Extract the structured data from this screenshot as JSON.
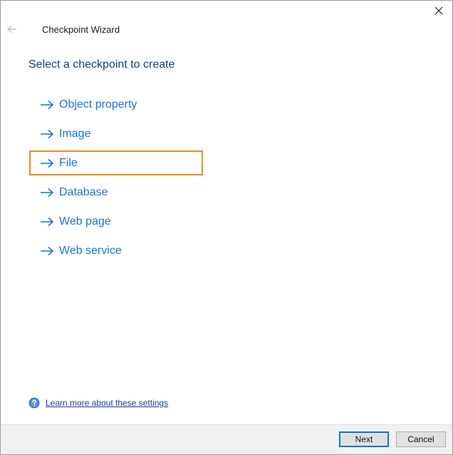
{
  "window": {
    "title": "Checkpoint Wizard",
    "close_icon": "close-icon",
    "back_icon": "back-arrow-icon"
  },
  "main": {
    "heading": "Select a checkpoint to create",
    "options": [
      {
        "label": "Object property",
        "selected": false
      },
      {
        "label": "Image",
        "selected": false
      },
      {
        "label": "File",
        "selected": true
      },
      {
        "label": "Database",
        "selected": false
      },
      {
        "label": "Web page",
        "selected": false
      },
      {
        "label": "Web service",
        "selected": false
      }
    ],
    "option_icon": "arrow-right-icon"
  },
  "help": {
    "link_text": "Learn more about these settings",
    "icon": "help-icon"
  },
  "footer": {
    "next_label": "Next",
    "cancel_label": "Cancel"
  },
  "colors": {
    "link": "#1a74c4",
    "heading": "#1a3d7c",
    "selection": "#f08a1e",
    "primary_border": "#0078d7"
  }
}
